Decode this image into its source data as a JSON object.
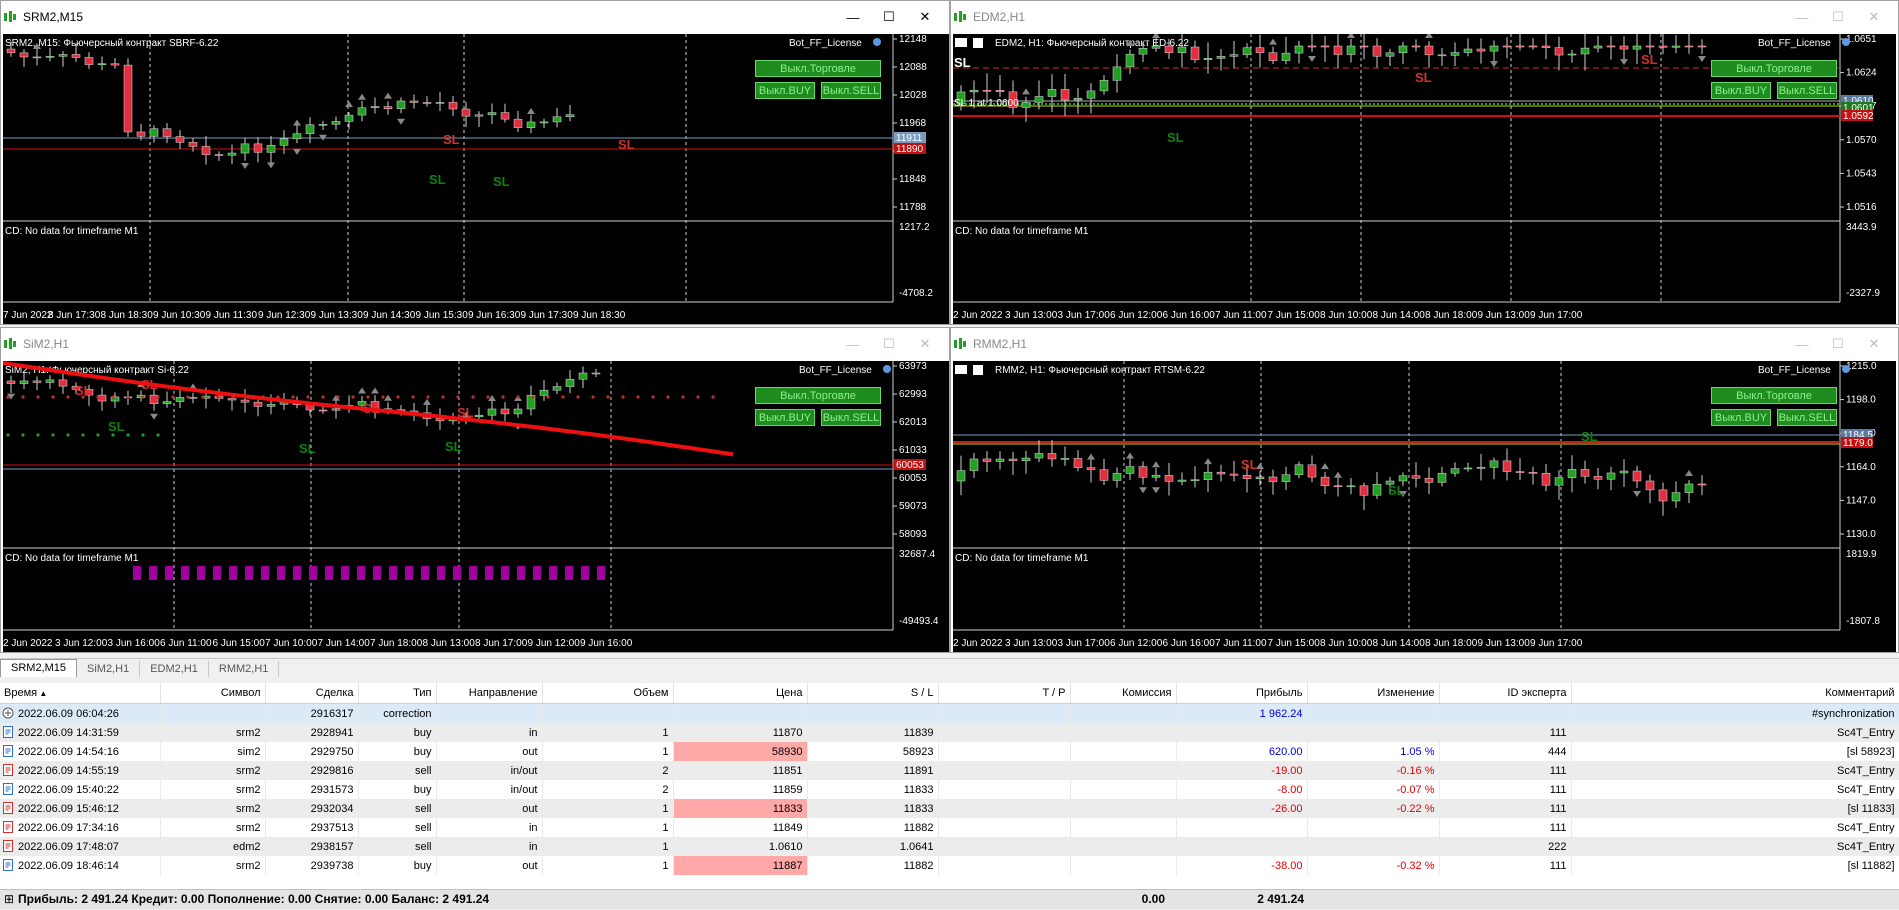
{
  "colors": {
    "bull": "#23a023",
    "bear": "#e03040",
    "sl_red": "#d03030",
    "sl_green": "#108010",
    "price_bid": "#c01010"
  },
  "windows": {
    "srm2": {
      "title": "SRM2,M15",
      "info": "SRM2, M15:  Фьючерсный контракт SBRF-6.22",
      "bot_label": "Bot_FF_License",
      "btn_trade": "Выкл.Торговле",
      "btn_buy": "Выкл.BUY",
      "btn_sell": "Выкл.SELL",
      "indicator_note": "CD: No data for timeframe M1",
      "price_labels": [
        "12148",
        "12088",
        "12028",
        "11968",
        "11908",
        "11848",
        "11788"
      ],
      "price_tag_1": "11911",
      "price_tag_2": "11890",
      "ind_labels": [
        "1217.2",
        "-4708.2"
      ],
      "time_labels": [
        "7 Jun 2022",
        "8 Jun 17:30",
        "8 Jun 18:30",
        "9 Jun 10:30",
        "9 Jun 11:30",
        "9 Jun 12:30",
        "9 Jun 13:30",
        "9 Jun 14:30",
        "9 Jun 15:30",
        "9 Jun 16:30",
        "9 Jun 17:30",
        "9 Jun 18:30"
      ],
      "sl_marks": [
        "SL",
        "SL",
        "SL",
        "SL"
      ]
    },
    "edm2": {
      "title": "EDM2,H1",
      "info": "EDM2, H1:  Фьючерсный контракт ED-6.22",
      "bot_label": "Bot_FF_License",
      "btn_trade": "Выкл.Торговле",
      "btn_buy": "Выкл.BUY",
      "btn_sell": "Выкл.SELL",
      "indicator_note": "CD: No data for timeframe M1",
      "sl_line_label": "SL",
      "sl_line_label_2": "SL 1 at 1.0600",
      "price_labels": [
        "1.0651",
        "1.0624",
        "1.0597",
        "1.0570",
        "1.0543",
        "1.0516"
      ],
      "price_tag_1": "1.0610",
      "price_tag_2": "1.0601",
      "price_tag_3": "1.0592",
      "ind_labels": [
        "3443.9",
        "-2327.9"
      ],
      "time_labels": [
        "2 Jun 2022",
        "3 Jun 13:00",
        "3 Jun 17:00",
        "6 Jun 12:00",
        "6 Jun 16:00",
        "7 Jun 11:00",
        "7 Jun 15:00",
        "8 Jun 10:00",
        "8 Jun 14:00",
        "8 Jun 18:00",
        "9 Jun 13:00",
        "9 Jun 17:00"
      ],
      "sl_marks": [
        "SL",
        "SL",
        "SL"
      ]
    },
    "sim2": {
      "title": "SiM2,H1",
      "info": "SiM2, H1:  Фьючерсный контракт Si-6.22",
      "bot_label": "Bot_FF_License",
      "btn_trade": "Выкл.Торговле",
      "btn_buy": "Выкл.BUY",
      "btn_sell": "Выкл.SELL",
      "indicator_note": "CD: No data for timeframe M1",
      "price_labels": [
        "63973",
        "62993",
        "62013",
        "61033",
        "60053",
        "59073",
        "58093"
      ],
      "price_tag_1": "60053",
      "ind_labels": [
        "32687.4",
        "-49493.4"
      ],
      "time_labels": [
        "2 Jun 2022",
        "3 Jun 12:00",
        "3 Jun 16:00",
        "6 Jun 11:00",
        "6 Jun 15:00",
        "7 Jun 10:00",
        "7 Jun 14:00",
        "7 Jun 18:00",
        "8 Jun 13:00",
        "8 Jun 17:00",
        "9 Jun 12:00",
        "9 Jun 16:00"
      ],
      "sl_marks": [
        "SL",
        "SL",
        "SL",
        "SL",
        "SL",
        "SL",
        "SL"
      ]
    },
    "rmm2": {
      "title": "RMM2,H1",
      "info": "RMM2, H1:  Фьючерсный контракт RTSM-6.22",
      "bot_label": "Bot_FF_License",
      "btn_trade": "Выкл.Торговле",
      "btn_buy": "Выкл.BUY",
      "btn_sell": "Выкл.SELL",
      "indicator_note": "CD: No data for timeframe M1",
      "price_labels": [
        "1215.0",
        "1198.0",
        "1181.0",
        "1164.0",
        "1147.0",
        "1130.0"
      ],
      "price_tag_1": "1184.5",
      "price_tag_2": "1179.0",
      "ind_labels": [
        "1819.9",
        "-1807.8"
      ],
      "time_labels": [
        "2 Jun 2022",
        "3 Jun 13:00",
        "3 Jun 17:00",
        "6 Jun 12:00",
        "6 Jun 16:00",
        "7 Jun 11:00",
        "7 Jun 15:00",
        "8 Jun 10:00",
        "8 Jun 14:00",
        "8 Jun 18:00",
        "9 Jun 13:00",
        "9 Jun 17:00"
      ],
      "sl_marks": [
        "SL",
        "SL",
        "SL"
      ]
    }
  },
  "tabs": [
    "SRM2,M15",
    "SiM2,H1",
    "EDM2,H1",
    "RMM2,H1"
  ],
  "table": {
    "columns": [
      "Время",
      "Символ",
      "Сделка",
      "Тип",
      "Направление",
      "Объем",
      "Цена",
      "S / L",
      "T / P",
      "Комиссия",
      "Прибыль",
      "Изменение",
      "ID эксперта",
      "Комментарий"
    ],
    "rows": [
      {
        "kind": "balance",
        "time": "2022.06.09 06:04:26",
        "symbol": "",
        "deal": "2916317",
        "type": "correction",
        "direction": "",
        "volume": "",
        "price": "",
        "sl": "",
        "tp": "",
        "commission": "",
        "profit": "1 962.24",
        "change": "",
        "expert": "",
        "comment": "#synchronization"
      },
      {
        "kind": "buy",
        "time": "2022.06.09 14:31:59",
        "symbol": "srm2",
        "deal": "2928941",
        "type": "buy",
        "direction": "in",
        "volume": "1",
        "price": "11870",
        "sl": "11839",
        "tp": "",
        "commission": "",
        "profit": "",
        "change": "",
        "expert": "111",
        "comment": "Sc4T_Entry"
      },
      {
        "kind": "buy",
        "time": "2022.06.09 14:54:16",
        "symbol": "sim2",
        "deal": "2929750",
        "type": "buy",
        "direction": "out",
        "volume": "1",
        "price": "58930",
        "sl": "58923",
        "tp": "",
        "commission": "",
        "profit": "620.00",
        "change": "1.05 %",
        "expert": "444",
        "comment": "[sl 58923]"
      },
      {
        "kind": "sell",
        "time": "2022.06.09 14:55:19",
        "symbol": "srm2",
        "deal": "2929816",
        "type": "sell",
        "direction": "in/out",
        "volume": "2",
        "price": "11851",
        "sl": "11891",
        "tp": "",
        "commission": "",
        "profit": "-19.00",
        "change": "-0.16 %",
        "expert": "111",
        "comment": "Sc4T_Entry"
      },
      {
        "kind": "buy",
        "time": "2022.06.09 15:40:22",
        "symbol": "srm2",
        "deal": "2931573",
        "type": "buy",
        "direction": "in/out",
        "volume": "2",
        "price": "11859",
        "sl": "11833",
        "tp": "",
        "commission": "",
        "profit": "-8.00",
        "change": "-0.07 %",
        "expert": "111",
        "comment": "Sc4T_Entry"
      },
      {
        "kind": "sell",
        "time": "2022.06.09 15:46:12",
        "symbol": "srm2",
        "deal": "2932034",
        "type": "sell",
        "direction": "out",
        "volume": "1",
        "price": "11833",
        "sl": "11833",
        "tp": "",
        "commission": "",
        "profit": "-26.00",
        "change": "-0.22 %",
        "expert": "111",
        "comment": "[sl 11833]"
      },
      {
        "kind": "sell",
        "time": "2022.06.09 17:34:16",
        "symbol": "srm2",
        "deal": "2937513",
        "type": "sell",
        "direction": "in",
        "volume": "1",
        "price": "11849",
        "sl": "11882",
        "tp": "",
        "commission": "",
        "profit": "",
        "change": "",
        "expert": "111",
        "comment": "Sc4T_Entry"
      },
      {
        "kind": "sell",
        "time": "2022.06.09 17:48:07",
        "symbol": "edm2",
        "deal": "2938157",
        "type": "sell",
        "direction": "in",
        "volume": "1",
        "price": "1.0610",
        "sl": "1.0641",
        "tp": "",
        "commission": "",
        "profit": "",
        "change": "",
        "expert": "222",
        "comment": "Sc4T_Entry"
      },
      {
        "kind": "buy",
        "time": "2022.06.09 18:46:14",
        "symbol": "srm2",
        "deal": "2939738",
        "type": "buy",
        "direction": "out",
        "volume": "1",
        "price": "11887",
        "sl": "11882",
        "tp": "",
        "commission": "",
        "profit": "-38.00",
        "change": "-0.32 %",
        "expert": "111",
        "comment": "[sl 11882]"
      }
    ],
    "highlighted_price_deals": [
      "2929750",
      "2932034",
      "2939738"
    ],
    "icons": {
      "balance": "balance-icon",
      "buy": "buy-deal-icon",
      "sell": "sell-deal-icon"
    }
  },
  "status": {
    "text": "Прибыль: 2 491.24  Кредит: 0.00  Пополнение: 0.00  Снятие: 0.00  Баланс: 2 491.24",
    "commission_total": "0.00",
    "profit_total": "2 491.24"
  }
}
